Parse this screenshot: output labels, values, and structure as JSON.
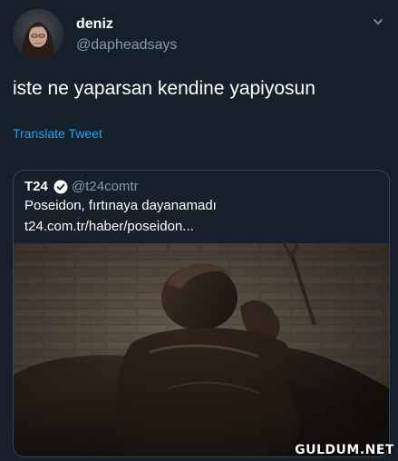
{
  "tweet": {
    "display_name": "deniz",
    "handle": "@dapheadsays",
    "text": "iste ne yaparsan kendine yapiyosun",
    "translate_label": "Translate Tweet",
    "avatar_icon": "user-avatar",
    "menu_icon": "chevron-down-icon"
  },
  "quoted_tweet": {
    "name": "T24",
    "verified_icon": "verified-badge-icon",
    "handle": "@t24comtr",
    "text": "Poseidon, fırtınaya dayanamadı",
    "link": "t24.com.tr/haber/poseidon..."
  },
  "watermark": "GULDUM.NET",
  "colors": {
    "background": "#15202b",
    "text_primary": "#ffffff",
    "text_secondary": "#8899a6",
    "link": "#1da1f2",
    "border": "#38444d"
  }
}
